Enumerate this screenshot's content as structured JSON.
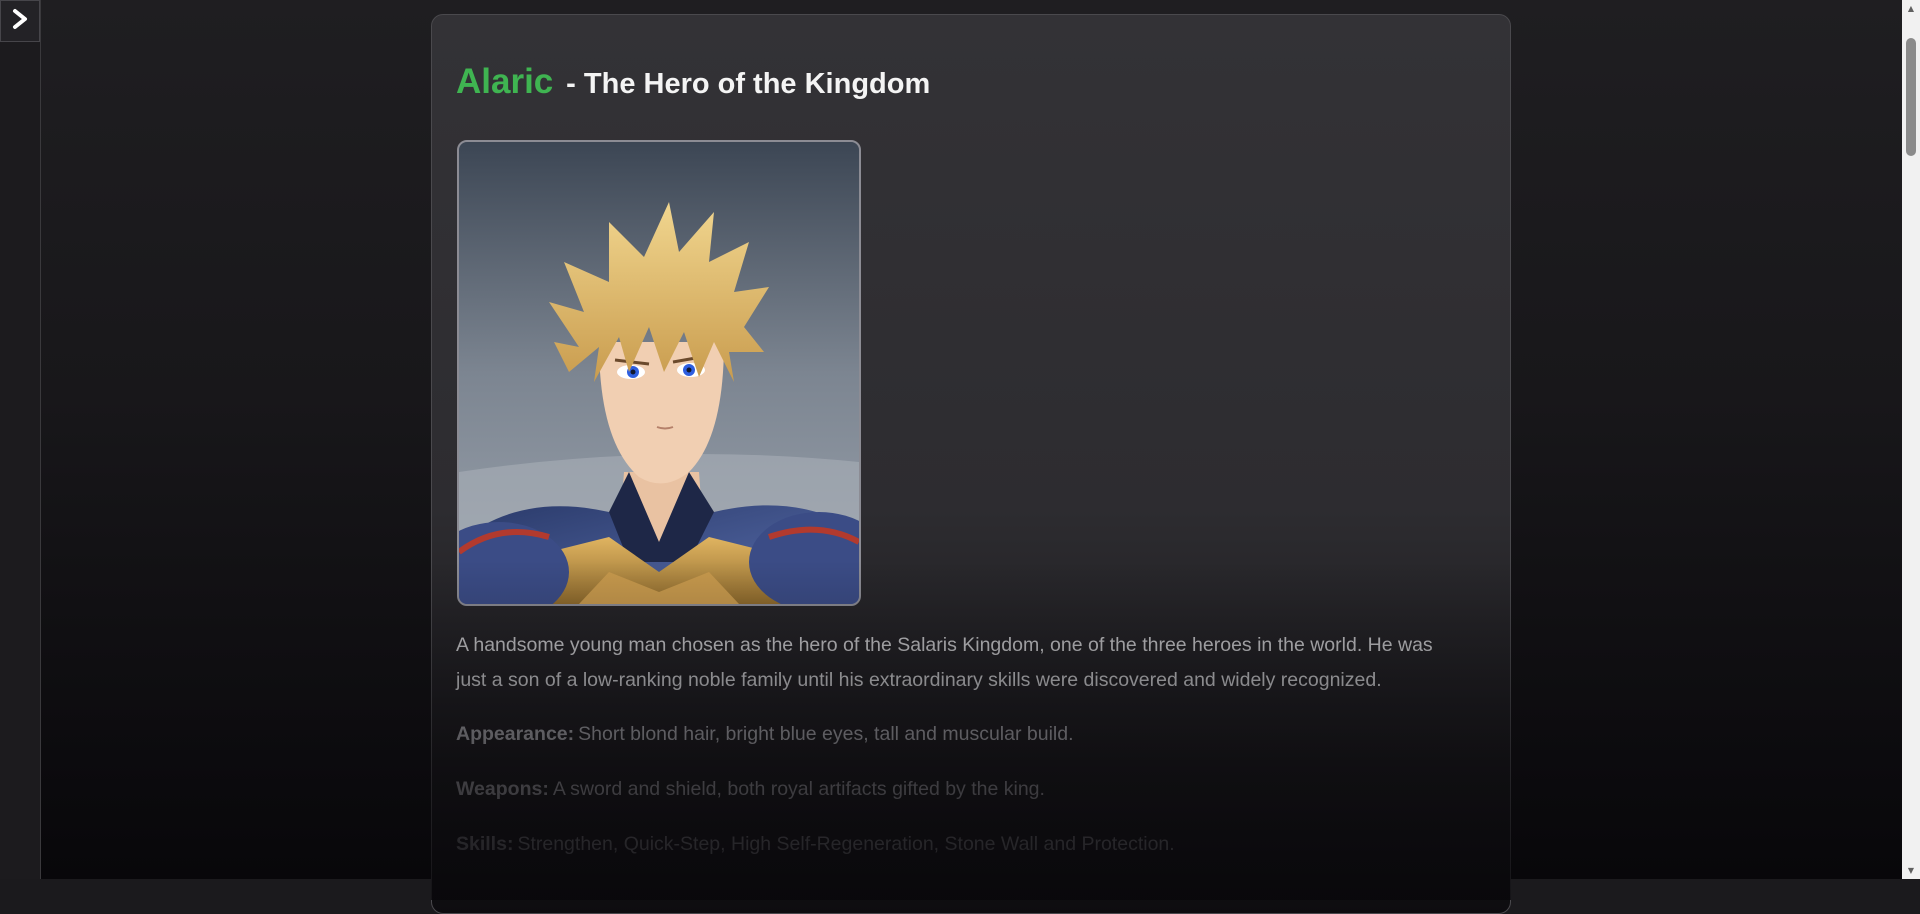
{
  "sidebar": {
    "toggle_icon": "chevron-right-icon"
  },
  "character": {
    "name": "Alaric",
    "title_suffix": "- The Hero of the Kingdom",
    "name_color": "#3fb451",
    "portrait": {
      "icon": "character-portrait-image",
      "alt": "Alaric"
    },
    "description": "A handsome young man chosen as the hero of the Salaris Kingdom, one of the three heroes in the world. He was just a son of a low-ranking noble family until his extraordinary skills were discovered and widely recognized.",
    "attributes": [
      {
        "label": "Appearance:",
        "value": "Short blond hair, bright blue eyes, tall and muscular build."
      },
      {
        "label": "Weapons:",
        "value": "A sword and shield, both royal artifacts gifted by the king."
      },
      {
        "label": "Skills:",
        "value": "Strengthen, Quick-Step, High Self-Regeneration, Stone Wall and Protection."
      }
    ]
  },
  "scrollbar": {
    "up_icon": "scroll-up-arrow-icon",
    "down_icon": "scroll-down-arrow-icon"
  }
}
